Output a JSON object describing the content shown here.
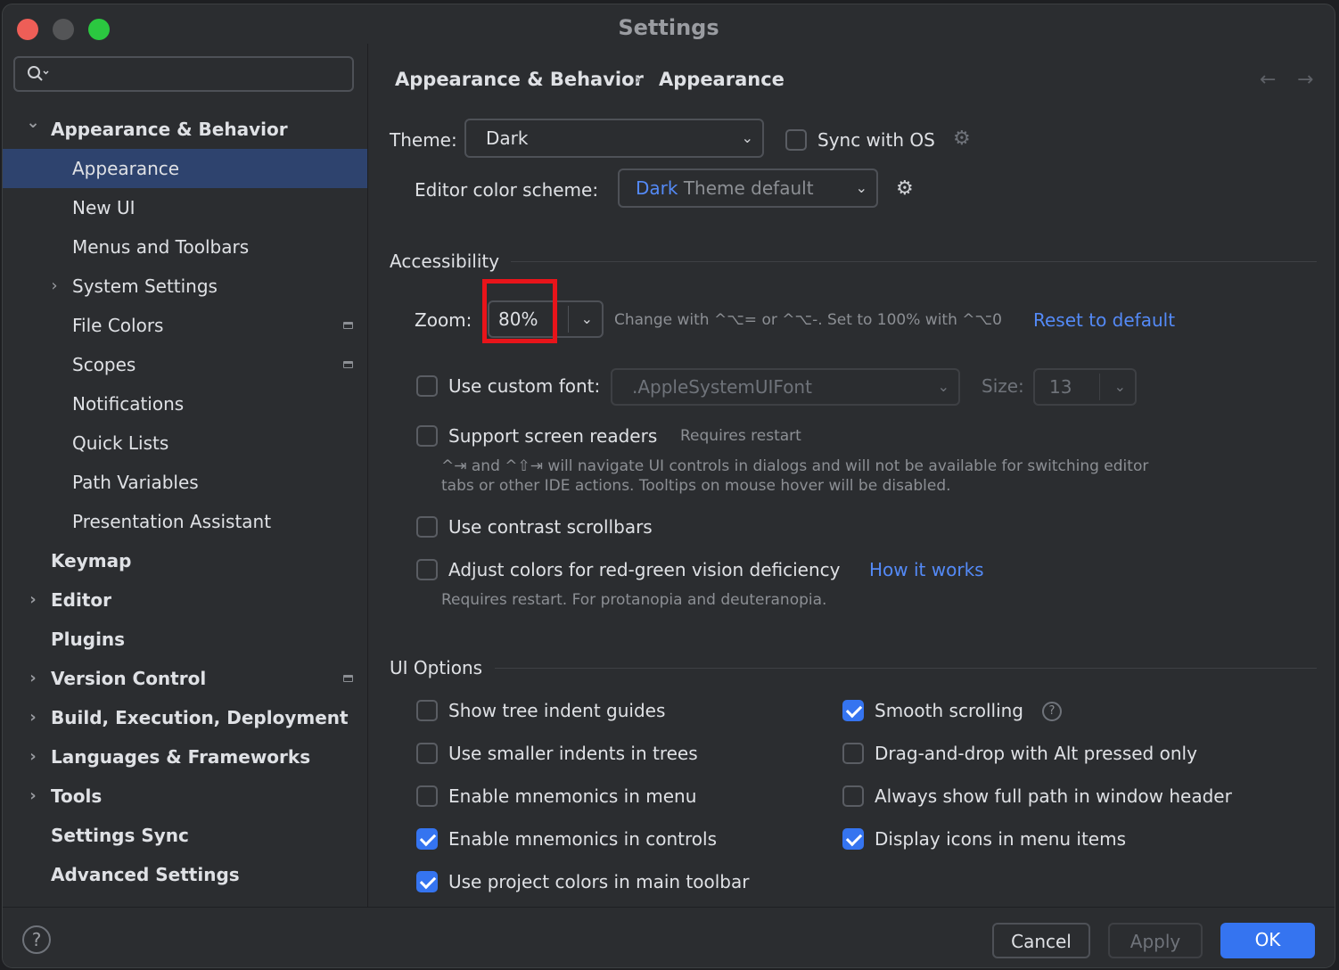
{
  "window": {
    "title": "Settings",
    "traffic_colors": {
      "close": "#ee5e57",
      "minimize": "#545557",
      "zoom": "#2bc840"
    }
  },
  "search": {
    "icon": "search-icon",
    "placeholder": ""
  },
  "sidebar": {
    "items": [
      {
        "label": "Appearance & Behavior",
        "expanded": true,
        "bold": true
      },
      {
        "label": "Appearance",
        "selected": true
      },
      {
        "label": "New UI"
      },
      {
        "label": "Menus and Toolbars"
      },
      {
        "label": "System Settings",
        "collapsed": true
      },
      {
        "label": "File Colors",
        "project_icon": true
      },
      {
        "label": "Scopes",
        "project_icon": true
      },
      {
        "label": "Notifications"
      },
      {
        "label": "Quick Lists"
      },
      {
        "label": "Path Variables"
      },
      {
        "label": "Presentation Assistant"
      },
      {
        "label": "Keymap",
        "bold": true
      },
      {
        "label": "Editor",
        "bold": true,
        "collapsed": true
      },
      {
        "label": "Plugins",
        "bold": true
      },
      {
        "label": "Version Control",
        "bold": true,
        "collapsed": true,
        "project_icon": true
      },
      {
        "label": "Build, Execution, Deployment",
        "bold": true,
        "collapsed": true
      },
      {
        "label": "Languages & Frameworks",
        "bold": true,
        "collapsed": true
      },
      {
        "label": "Tools",
        "bold": true,
        "collapsed": true
      },
      {
        "label": "Settings Sync",
        "bold": true
      },
      {
        "label": "Advanced Settings",
        "bold": true
      }
    ]
  },
  "breadcrumb": {
    "parent": "Appearance & Behavior",
    "separator": "›",
    "current": "Appearance",
    "back": "←",
    "forward": "→"
  },
  "theme": {
    "label": "Theme:",
    "value": "Dark",
    "sync_label": "Sync with OS",
    "sync_checked": false
  },
  "scheme": {
    "label": "Editor color scheme:",
    "value_prefix": "Dark",
    "value_rest": " Theme default"
  },
  "accessibility": {
    "heading": "Accessibility",
    "zoom_label": "Zoom:",
    "zoom_value": "80%",
    "zoom_hint": "Change with ^⌥= or ^⌥-. Set to 100% with ^⌥0",
    "reset_link": "Reset to default",
    "custom_font_label": "Use custom font:",
    "custom_font_checked": false,
    "font_value": ".AppleSystemUIFont",
    "size_label": "Size:",
    "size_value": "13",
    "screen_readers_label": "Support screen readers",
    "screen_readers_checked": false,
    "requires_restart": "Requires restart",
    "screen_readers_note_1": "^⇥ and ^⇧⇥ will navigate UI controls in dialogs and will not be available for switching editor",
    "screen_readers_note_2": "tabs or other IDE actions. Tooltips on mouse hover will be disabled.",
    "contrast_label": "Use contrast scrollbars",
    "contrast_checked": false,
    "colorblind_label": "Adjust colors for red-green vision deficiency",
    "colorblind_checked": false,
    "how_link": "How it works",
    "colorblind_note": "Requires restart. For protanopia and deuteranopia."
  },
  "ui_options": {
    "heading": "UI Options",
    "left": [
      {
        "label": "Show tree indent guides",
        "checked": false
      },
      {
        "label": "Use smaller indents in trees",
        "checked": false
      },
      {
        "label": "Enable mnemonics in menu",
        "checked": false
      },
      {
        "label": "Enable mnemonics in controls",
        "checked": true
      },
      {
        "label": "Use project colors in main toolbar",
        "checked": true
      }
    ],
    "right": [
      {
        "label": "Smooth scrolling",
        "checked": true
      },
      {
        "label": "Drag-and-drop with Alt pressed only",
        "checked": false
      },
      {
        "label": "Always show full path in window header",
        "checked": false
      },
      {
        "label": "Display icons in menu items",
        "checked": true
      }
    ]
  },
  "footer": {
    "help": "?",
    "cancel": "Cancel",
    "apply": "Apply",
    "ok": "OK"
  },
  "colors": {
    "accent": "#3574f0",
    "link": "#548af7",
    "highlight_box": "#e8141a",
    "selection": "#2e436e"
  }
}
